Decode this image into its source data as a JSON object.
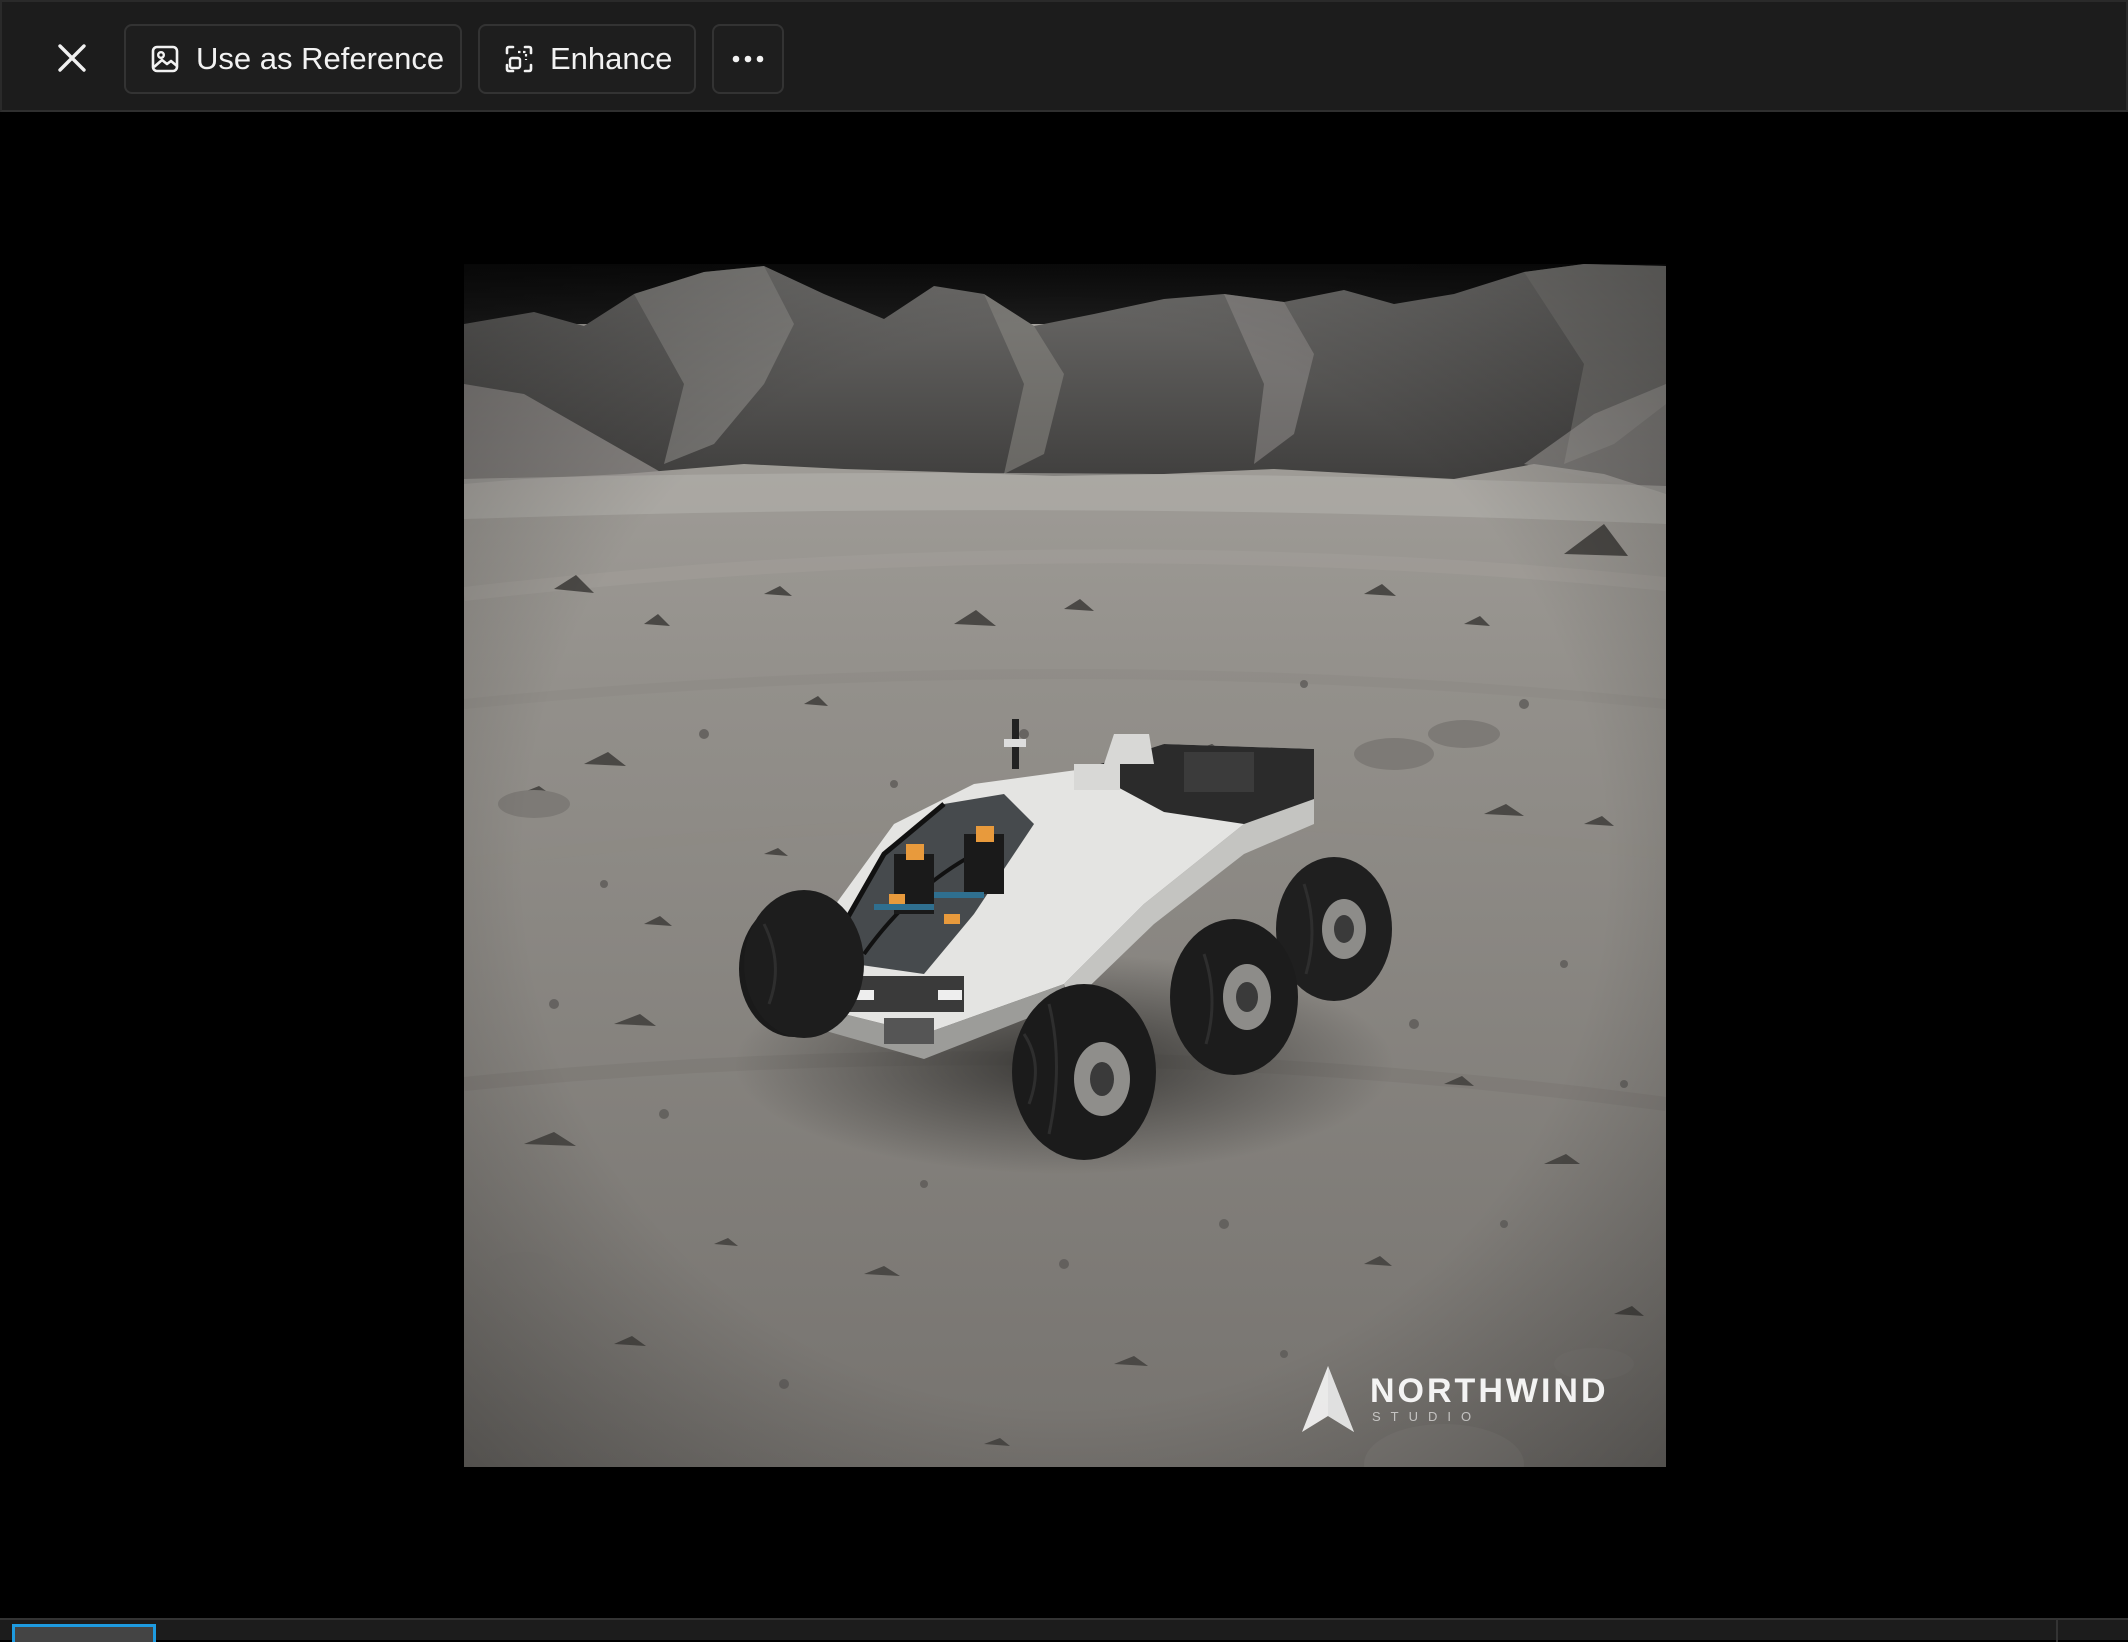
{
  "toolbar": {
    "close_icon": "close-icon",
    "use_as_reference": {
      "label": "Use as Reference",
      "icon": "image-icon"
    },
    "enhance": {
      "label": "Enhance",
      "icon": "enhance-icon"
    },
    "more": {
      "icon": "more-horizontal-icon"
    }
  },
  "image": {
    "watermark": {
      "name": "NORTHWIND",
      "sub": "STUDIO"
    }
  },
  "colors": {
    "toolbar_bg": "#1c1c1c",
    "viewer_bg": "#000000",
    "selected_thumb_border": "#1e9be0"
  }
}
